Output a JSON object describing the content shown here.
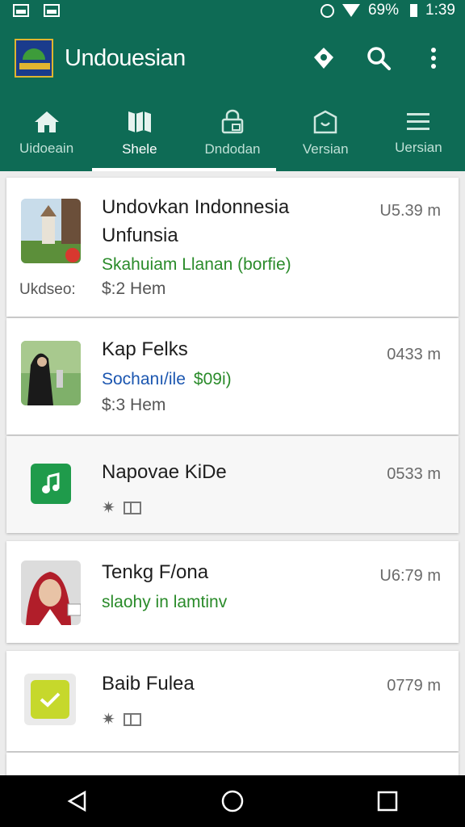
{
  "status_bar": {
    "battery": "69%",
    "time": "1:39"
  },
  "app_bar": {
    "title": "Undouesian",
    "actions": [
      "location-icon",
      "search-icon",
      "more-vert-icon"
    ]
  },
  "tabs": [
    {
      "label": "Uidoeain",
      "icon": "home-icon"
    },
    {
      "label": "Shele",
      "icon": "map-icon",
      "active": true
    },
    {
      "label": "Dndodan",
      "icon": "lock-icon"
    },
    {
      "label": "Versian",
      "icon": "bag-icon"
    },
    {
      "label": "Uersian",
      "icon": "menu-icon"
    }
  ],
  "cards": [
    {
      "title1": "Undovkan Indonnesia",
      "title2": "Unfunsia",
      "time": "U5.39 m",
      "subtitle": "Skahuiam Llanan (borfie)",
      "side": "Ukdseo:",
      "meta": "$:2 Hem"
    },
    {
      "title1": "Kap Felks",
      "time": "0433 m",
      "subtitle_blue": "Sochanı/ile",
      "subtitle_green": "$09i)",
      "meta": "$:3 Hem"
    },
    {
      "title1": "Napovae KiDe",
      "time": "0533 m"
    },
    {
      "title1": "Tenkg F/ona",
      "time": "U6:79 m",
      "subtitle": "slaohy in lamtinv"
    },
    {
      "title1": "Baib Fulea",
      "time": "0779 m"
    }
  ],
  "colors": {
    "primary": "#0e6b55",
    "green_text": "#2a8b2a",
    "blue_text": "#1b56b0"
  }
}
